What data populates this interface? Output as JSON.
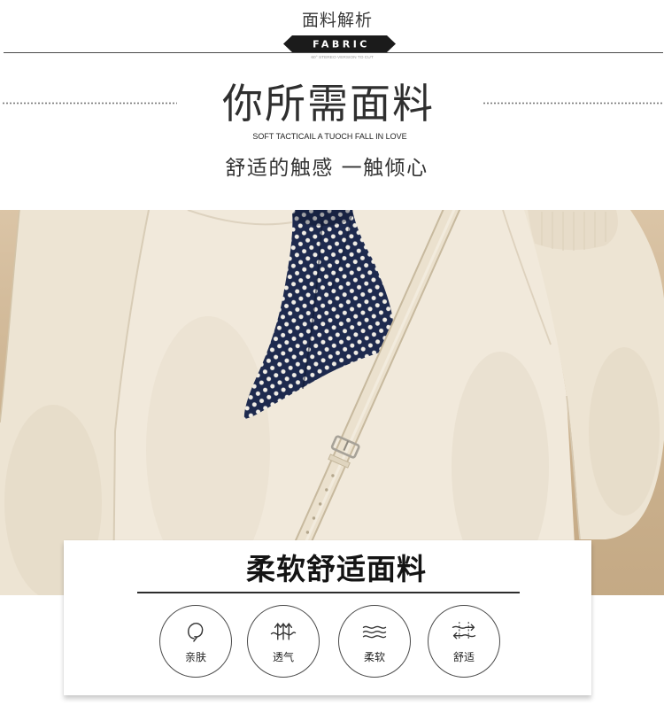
{
  "header": {
    "title": "面料解析",
    "ribbon_label": "FABRIC",
    "caption": "60° STEREO VERSION TO CUT"
  },
  "intro": {
    "headline": "你所需面料",
    "tagline": "SOFT TACTICAIL A TUOCH FALL IN LOVE",
    "subheadline": "舒适的触感 一触倾心"
  },
  "photo": {
    "colors": {
      "backdrop": "#d3b893",
      "sweater": "#f1e9db",
      "sleeve": "#ede4d3",
      "scarf": "#1e2a4e",
      "scarf_dots": "#f2eee6",
      "strap": "#ebe1ce",
      "buckle": "#a7a298"
    }
  },
  "features": {
    "title": "柔软舒适面料",
    "items": [
      {
        "label": "亲肤",
        "icon": "skin-friendly-icon"
      },
      {
        "label": "透气",
        "icon": "breathable-icon"
      },
      {
        "label": "柔软",
        "icon": "soft-icon"
      },
      {
        "label": "舒适",
        "icon": "comfort-icon"
      }
    ]
  },
  "theme": {
    "ink": "#333333",
    "ribbon": "#1b1b1b"
  }
}
